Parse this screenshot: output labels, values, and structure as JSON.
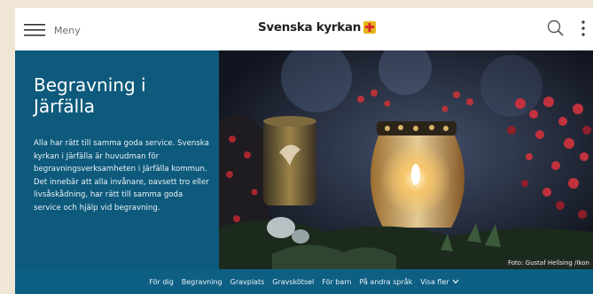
{
  "header": {
    "menu_label": "Meny",
    "logo_text": "Svenska kyrkan",
    "accent_color": "#e8b41a",
    "cross_color": "#d62a2a"
  },
  "hero": {
    "title": "Begravning i Järfälla",
    "body": "Alla har rätt till samma goda service. Svenska kyrkan i Järfälla är huvudman för begravningsverksamheten i Järfälla kommun. Det innebär att alla invånare, oavsett tro eller livsåskådning, har rätt till samma goda service och hjälp vid begravning.",
    "photo_credit": "Foto: Gustaf Hellsing /Ikon",
    "panel_color": "#0e5a7c"
  },
  "nav": {
    "items": [
      "För dig",
      "Begravning",
      "Gravplats",
      "Gravskötsel",
      "För barn",
      "På andra språk"
    ],
    "more_label": "Visa fler"
  },
  "icons": [
    "hamburger-menu-icon",
    "svenska-kyrkan-cross-icon",
    "search-icon",
    "more-vertical-icon",
    "chevron-down-icon"
  ]
}
